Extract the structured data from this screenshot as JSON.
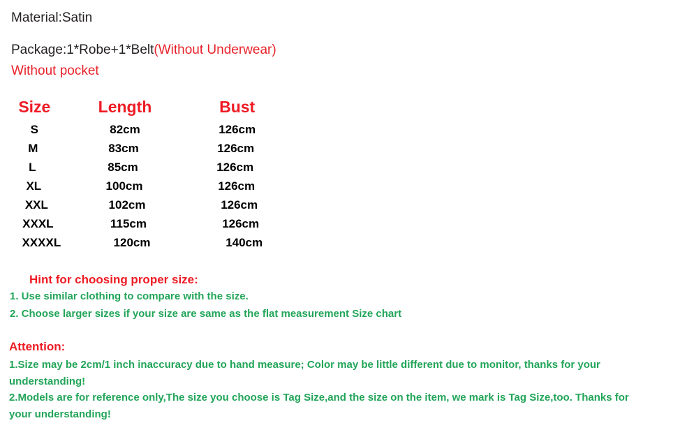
{
  "document": {
    "intro": {
      "material": "Material:Satin",
      "package_black": "Package:1*Robe+1*Belt",
      "package_red": "(Without Underwear)",
      "without_pocket": "Without pocket"
    },
    "size_chart": {
      "headers": [
        "Size",
        "Length",
        "Bust"
      ],
      "rows": [
        {
          "size": "S",
          "length": "82cm",
          "bust": "126cm"
        },
        {
          "size": "M",
          "length": "83cm",
          "bust": "126cm"
        },
        {
          "size": "L",
          "length": "85cm",
          "bust": "126cm"
        },
        {
          "size": "XL",
          "length": "100cm",
          "bust": "126cm"
        },
        {
          "size": "XXL",
          "length": "102cm",
          "bust": "126cm"
        },
        {
          "size": "XXXL",
          "length": "115cm",
          "bust": "126cm"
        },
        {
          "size": "XXXXL",
          "length": "120cm",
          "bust": "140cm"
        }
      ]
    },
    "hint": {
      "title": "Hint for choosing proper size:",
      "items": [
        "1. Use similar clothing to compare with the size.",
        "2. Choose larger sizes if your size are same as the flat measurement Size chart"
      ]
    },
    "attention": {
      "title": "Attention:",
      "item1_line1": "1.Size may be 2cm/1 inch inaccuracy due to hand measure; Color may be little different   due to monitor, thanks for your",
      "item1_line2": "understanding!",
      "item2_line1": "2.Models are for reference only,The size you choose is Tag Size,and the size on the item,  we mark is Tag Size,too. Thanks for",
      "item2_line2": "your understanding!"
    },
    "colors": {
      "red_heading": "#ee1b24",
      "red_note": "#e8222a",
      "green_text": "#22a559",
      "black_text": "#231f20",
      "background": "#ffffff"
    }
  }
}
